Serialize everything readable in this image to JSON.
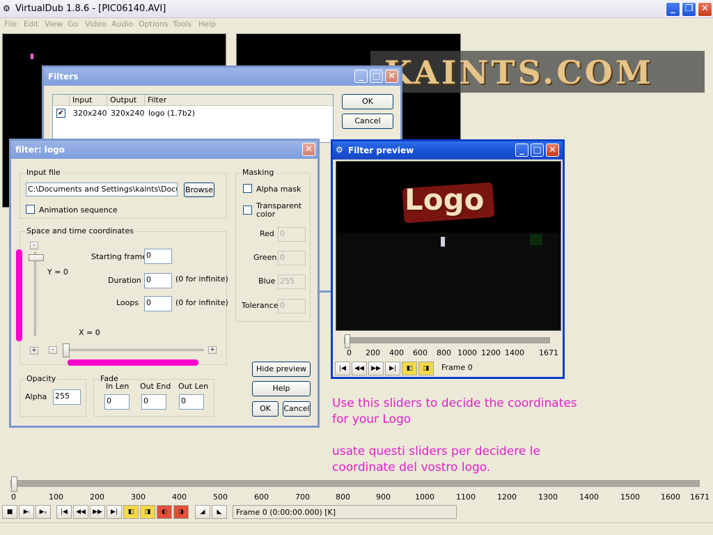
{
  "app": {
    "title": "VirtualDub 1.8.6 - [PIC06140.AVI]"
  },
  "menu": [
    "File",
    "Edit",
    "View",
    "Go",
    "Video",
    "Audio",
    "Options",
    "Tools",
    "Help"
  ],
  "watermark": {
    "text": "KAINTS.COM"
  },
  "filters_dialog": {
    "title": "Filters",
    "columns": [
      "Input",
      "Output",
      "Filter"
    ],
    "rows": [
      {
        "input": "320x240",
        "output": "320x240",
        "filter": "logo (1.7b2)"
      }
    ],
    "ok": "OK",
    "cancel": "Cancel"
  },
  "logo_dialog": {
    "title": "filter: logo",
    "input_file": {
      "label": "Input file",
      "value": "C:\\Documents and Settings\\kaints\\Docume",
      "browse": "Browse",
      "animation": "Animation sequence"
    },
    "coords": {
      "label": "Space and time coordinates",
      "y_label": "Y = 0",
      "x_label": "X = 0",
      "starting_frame_label": "Starting frame",
      "starting_frame": "0",
      "duration_label": "Duration",
      "duration": "0",
      "duration_note": "(0 for infinite)",
      "loops_label": "Loops",
      "loops": "0",
      "loops_note": "(0 for infinite)",
      "minus": "-",
      "plus": "+"
    },
    "masking": {
      "label": "Masking",
      "alpha_mask": "Alpha mask",
      "transparent": "Transparent color",
      "red_label": "Red",
      "red": "0",
      "green_label": "Green",
      "green": "0",
      "blue_label": "Blue",
      "blue": "255",
      "tolerance_label": "Tolerance",
      "tolerance": "0"
    },
    "opacity": {
      "label": "Opacity",
      "alpha_label": "Alpha",
      "alpha": "255"
    },
    "fade": {
      "label": "Fade",
      "in_len_label": "In Len",
      "in_len": "0",
      "out_end_label": "Out End",
      "out_end": "0",
      "out_len_label": "Out Len",
      "out_len": "0"
    },
    "hide_preview": "Hide preview",
    "help": "Help",
    "ok": "OK",
    "cancel": "Cancel"
  },
  "preview": {
    "title": "Filter preview",
    "logo_text": "Logo",
    "ticks": [
      "0",
      "200",
      "400",
      "600",
      "800",
      "1000",
      "1200",
      "1400",
      "1671"
    ],
    "frame_text": "Frame 0"
  },
  "annotation": {
    "en_1": "Use this sliders to decide the coordinates",
    "en_2": "for your Logo",
    "it_1": "usate questi sliders per decidere le",
    "it_2": "coordinate del vostro logo."
  },
  "timeline": {
    "ticks": [
      "0",
      "100",
      "200",
      "300",
      "400",
      "500",
      "600",
      "700",
      "800",
      "900",
      "1000",
      "1100",
      "1200",
      "1300",
      "1400",
      "1500",
      "1600",
      "1671"
    ],
    "frame_text": "Frame 0 (0:00:00.000) [K]"
  },
  "colors": {
    "annotation": "#e020c8",
    "highlight": "#ff00cc"
  }
}
